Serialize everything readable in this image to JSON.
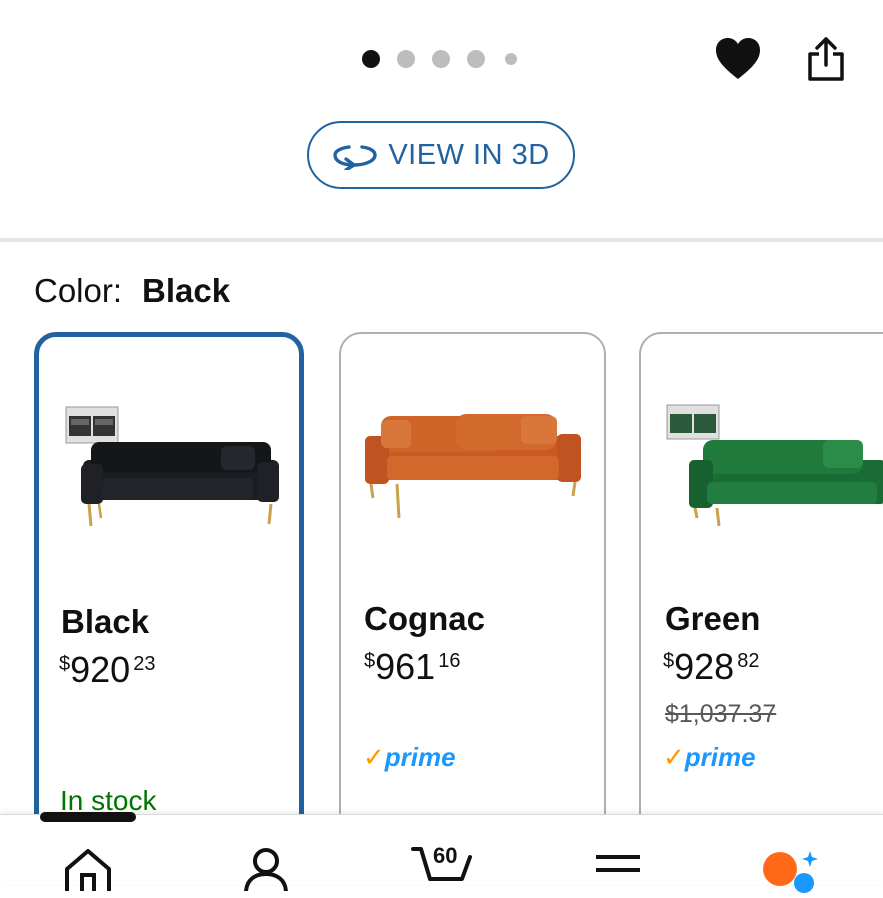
{
  "carousel": {
    "dots": 5,
    "active_index": 0
  },
  "actions": {
    "favorite_icon": "heart-icon",
    "share_icon": "share-icon"
  },
  "view3d": {
    "label": "VIEW IN 3D",
    "icon": "rotate-3d-icon",
    "color": "#2162a1"
  },
  "color_selector": {
    "label": "Color:",
    "selected": "Black",
    "options": [
      {
        "name": "Black",
        "price_symbol": "$",
        "price_whole": "920",
        "price_fraction": "23",
        "old_price": "",
        "prime": false,
        "stock": "In stock",
        "selected": true
      },
      {
        "name": "Cognac",
        "price_symbol": "$",
        "price_whole": "961",
        "price_fraction": "16",
        "old_price": "",
        "prime": true,
        "stock": "",
        "selected": false
      },
      {
        "name": "Green",
        "price_symbol": "$",
        "price_whole": "928",
        "price_fraction": "82",
        "old_price": "$1,037.37",
        "prime": true,
        "stock": "",
        "selected": false
      }
    ]
  },
  "prime_label": "prime",
  "bottom_nav": {
    "cart_count": "60",
    "items": [
      "home-icon",
      "account-icon",
      "cart-icon",
      "menu-icon",
      "rufus-icon"
    ]
  },
  "colors": {
    "accent": "#2162a1",
    "in_stock": "#007600",
    "prime_blue": "#1a98ff",
    "prime_check": "#ff9900"
  }
}
